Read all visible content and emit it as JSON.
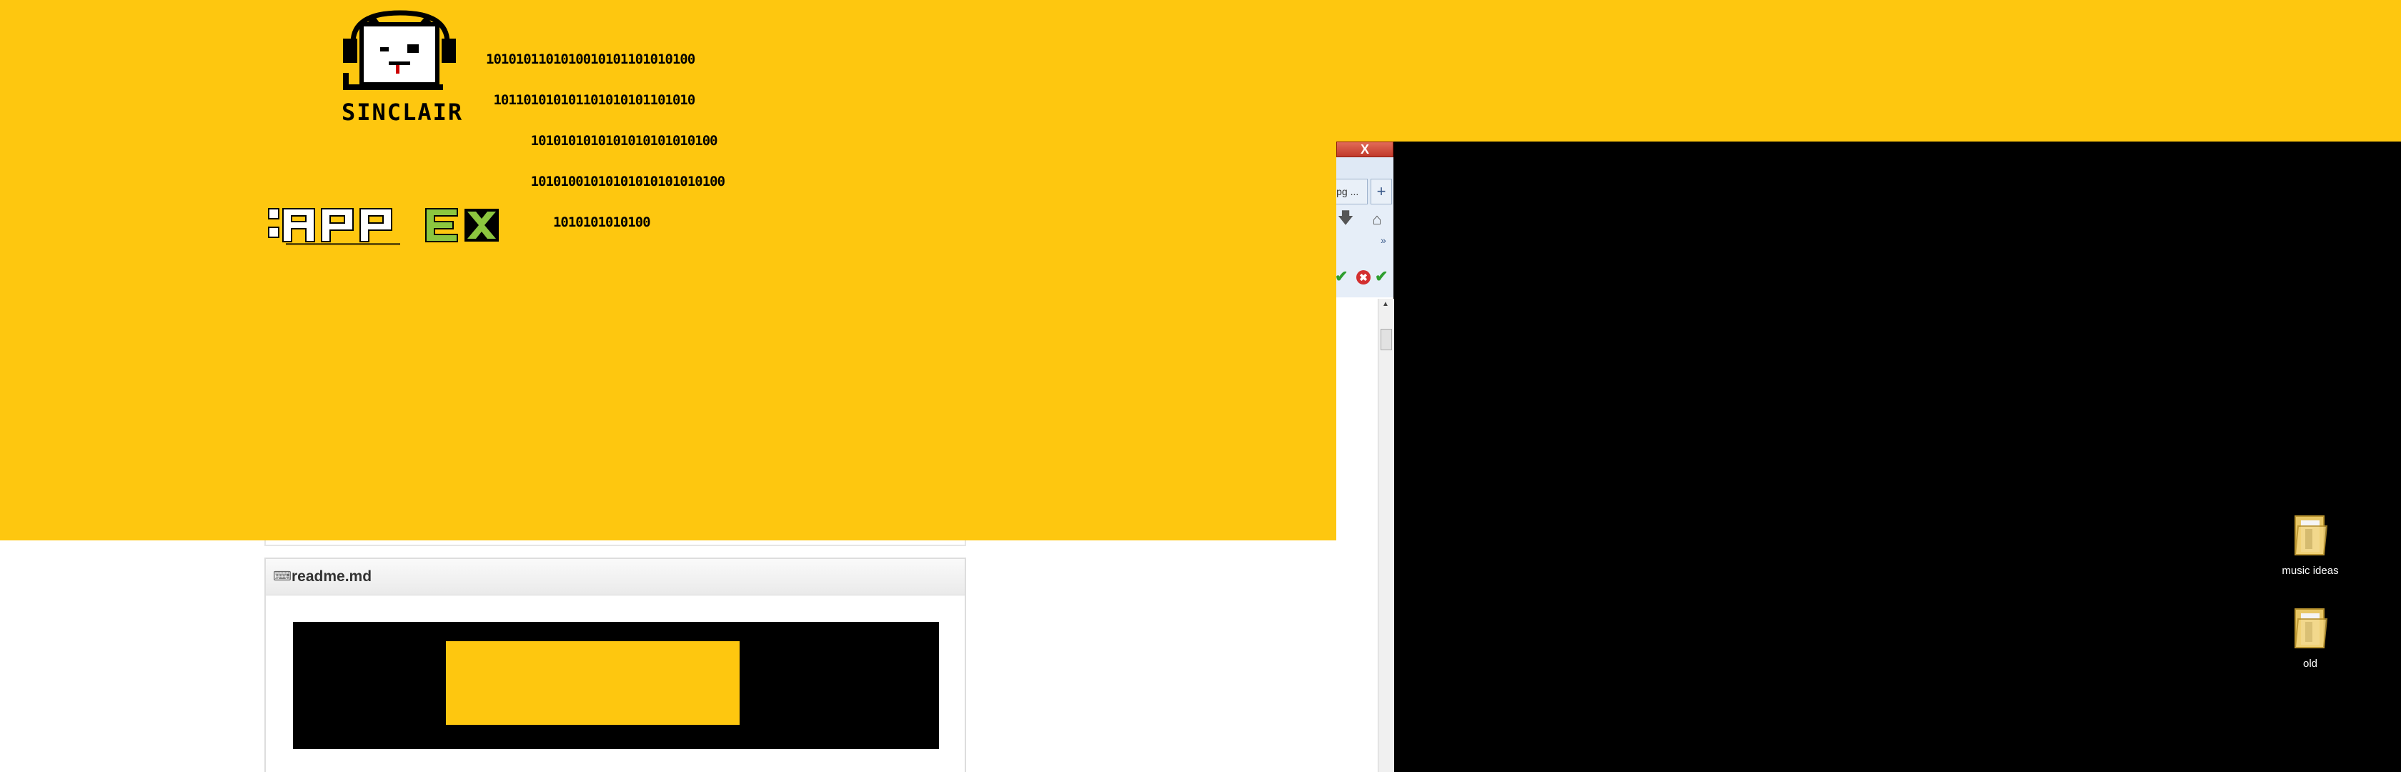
{
  "wallpaper": {
    "brand": "SINCLAIR",
    "binary_lines": [
      "1010101101010010101101010100",
      " 101101010101101010101101010",
      "      1010101010101010101010100",
      "      10101001010101010101010100",
      "         1010101010100"
    ],
    "logo": "APPEX",
    "colors": {
      "yellow": "#fec70f",
      "black": "#000000",
      "green": "#8cc63f"
    }
  },
  "browser": {
    "close_label": "X",
    "tab_label": "jpg ...",
    "new_tab_label": "+",
    "overflow_label": "»",
    "scroll_up": "▲"
  },
  "readme": {
    "title": "readme.md"
  },
  "desktop": {
    "icons": [
      {
        "label": "music ideas"
      },
      {
        "label": "old"
      }
    ]
  }
}
